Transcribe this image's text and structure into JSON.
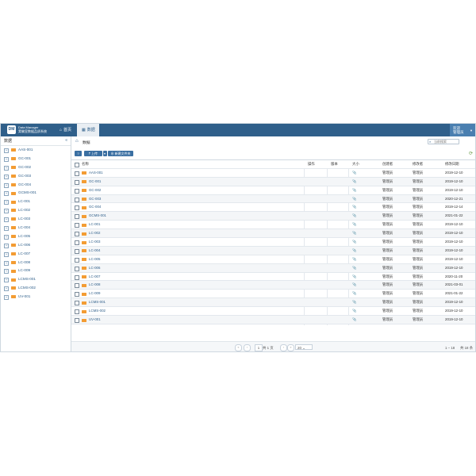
{
  "header": {
    "brand_line1": "Data Manager",
    "brand_line2": "実験室数据品质系统",
    "tabs": [
      {
        "label": "首页",
        "icon": "home-icon"
      },
      {
        "label": "数据",
        "icon": "grid-icon"
      }
    ],
    "user_line1": "欢迎",
    "user_line2": "管理员"
  },
  "sidebar": {
    "title": "数据",
    "collapse_label": "«",
    "items": [
      {
        "label": "AAS-001"
      },
      {
        "label": "GC-001"
      },
      {
        "label": "GC-002"
      },
      {
        "label": "GC-003"
      },
      {
        "label": "GC-004"
      },
      {
        "label": "GCMS-001"
      },
      {
        "label": "LC-001"
      },
      {
        "label": "LC-002"
      },
      {
        "label": "LC-003"
      },
      {
        "label": "LC-004"
      },
      {
        "label": "LC-005"
      },
      {
        "label": "LC-006"
      },
      {
        "label": "LC-007"
      },
      {
        "label": "LC-008"
      },
      {
        "label": "LC-009"
      },
      {
        "label": "LCMS-001"
      },
      {
        "label": "LCMS-002"
      },
      {
        "label": "UV-001"
      }
    ]
  },
  "main": {
    "breadcrumb": "数据",
    "search_placeholder": "当前搜索",
    "toolbar": {
      "help_label": "?",
      "upload_label": "上传",
      "upload_caret": "▾",
      "new_folder_label": "新建文件夹"
    },
    "columns": [
      "名称",
      "操作",
      "版本",
      "大小",
      "创建者",
      "修改者",
      "修改日期"
    ],
    "rows": [
      {
        "name": "AAS-001",
        "creator": "管理员",
        "modifier": "管理员",
        "date": "2019-12-10"
      },
      {
        "name": "GC-001",
        "creator": "管理员",
        "modifier": "管理员",
        "date": "2019-12-10"
      },
      {
        "name": "GC-002",
        "creator": "管理员",
        "modifier": "管理员",
        "date": "2019-12-10"
      },
      {
        "name": "GC-003",
        "creator": "管理员",
        "modifier": "管理员",
        "date": "2020-12-21"
      },
      {
        "name": "GC-004",
        "creator": "管理员",
        "modifier": "管理员",
        "date": "2019-12-14"
      },
      {
        "name": "GCMS-001",
        "creator": "管理员",
        "modifier": "管理员",
        "date": "2021-01-22"
      },
      {
        "name": "LC-001",
        "creator": "管理员",
        "modifier": "管理员",
        "date": "2019-12-10"
      },
      {
        "name": "LC-002",
        "creator": "管理员",
        "modifier": "管理员",
        "date": "2019-12-10"
      },
      {
        "name": "LC-003",
        "creator": "管理员",
        "modifier": "管理员",
        "date": "2019-12-10"
      },
      {
        "name": "LC-004",
        "creator": "管理员",
        "modifier": "管理员",
        "date": "2019-12-10"
      },
      {
        "name": "LC-005",
        "creator": "管理员",
        "modifier": "管理员",
        "date": "2019-12-10"
      },
      {
        "name": "LC-006",
        "creator": "管理员",
        "modifier": "管理员",
        "date": "2019-12-10"
      },
      {
        "name": "LC-007",
        "creator": "管理员",
        "modifier": "管理员",
        "date": "2020-11-20"
      },
      {
        "name": "LC-008",
        "creator": "管理员",
        "modifier": "管理员",
        "date": "2021-03-01"
      },
      {
        "name": "LC-009",
        "creator": "管理员",
        "modifier": "管理员",
        "date": "2021-01-22"
      },
      {
        "name": "LCMS-001",
        "creator": "管理员",
        "modifier": "管理员",
        "date": "2019-12-10"
      },
      {
        "name": "LCMS-002",
        "creator": "管理员",
        "modifier": "管理员",
        "date": "2019-12-10"
      },
      {
        "name": "UV-001",
        "creator": "管理员",
        "modifier": "管理员",
        "date": "2019-12-10"
      }
    ],
    "pager": {
      "first": "«",
      "prev": "‹",
      "page": "1",
      "of_text": "共 1 页",
      "next": "›",
      "last": "»",
      "page_size": "20",
      "range": "1 – 18",
      "total": "共 18 条"
    }
  },
  "colors": {
    "header_bg": "#2f5f8a",
    "folder": "#f39c33",
    "link": "#2f5f8a"
  }
}
